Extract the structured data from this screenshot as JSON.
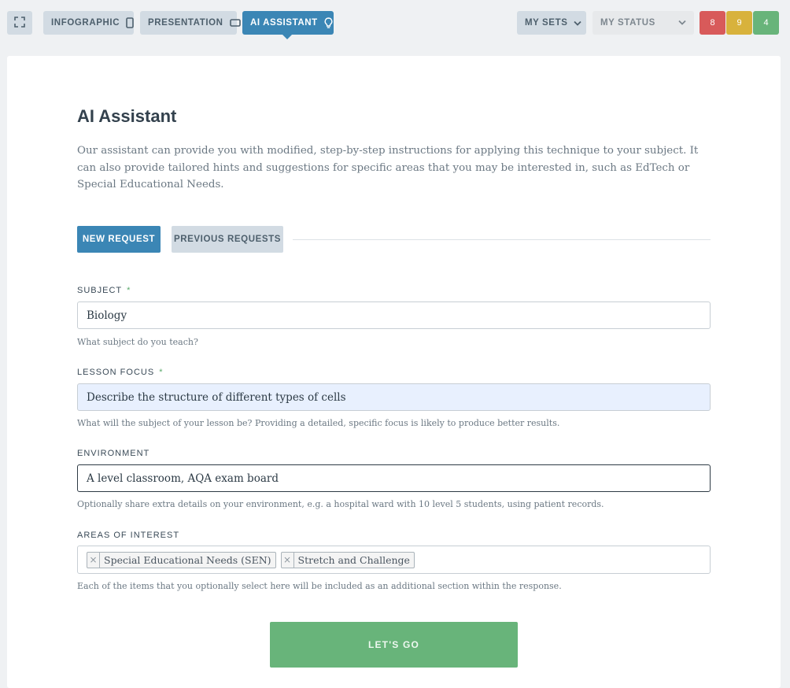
{
  "toolbar": {
    "fullscreen_icon": "fullscreen-icon",
    "infographic_label": "INFOGRAPHIC",
    "presentation_label": "PRESENTATION",
    "ai_assistant_label": "AI ASSISTANT",
    "my_sets_label": "MY SETS",
    "my_status_label": "MY STATUS",
    "counts": {
      "red": "8",
      "yellow": "9",
      "green": "4"
    },
    "colors": {
      "red": "#d85a5a",
      "yellow": "#d8b23c",
      "green": "#68b47a",
      "active": "#3b86b5"
    }
  },
  "page": {
    "title": "AI Assistant",
    "intro": "Our assistant can provide you with modified, step-by-step instructions for applying this technique to your subject. It can also provide tailored hints and suggestions for specific areas that you may be interested in, such as EdTech or Special Educational Needs."
  },
  "tabs": {
    "new_request": "NEW REQUEST",
    "previous_requests": "PREVIOUS REQUESTS"
  },
  "form": {
    "subject": {
      "label": "SUBJECT",
      "required": "*",
      "value": "Biology",
      "help": "What subject do you teach?"
    },
    "lesson_focus": {
      "label": "LESSON FOCUS",
      "required": "*",
      "value": "Describe the structure of different types of cells",
      "help": "What will the subject of your lesson be? Providing a detailed, specific focus is likely to produce better results."
    },
    "environment": {
      "label": "ENVIRONMENT",
      "value": "A level classroom, AQA exam board",
      "help": "Optionally share extra details on your environment, e.g. a hospital ward with 10 level 5 students, using patient records."
    },
    "areas_of_interest": {
      "label": "AREAS OF INTEREST",
      "tags": [
        {
          "remove": "×",
          "text": "Special Educational Needs (SEN)"
        },
        {
          "remove": "×",
          "text": "Stretch and Challenge"
        }
      ],
      "help": "Each of the items that you optionally select here will be included as an additional section within the response."
    },
    "submit_label": "LET'S GO"
  }
}
